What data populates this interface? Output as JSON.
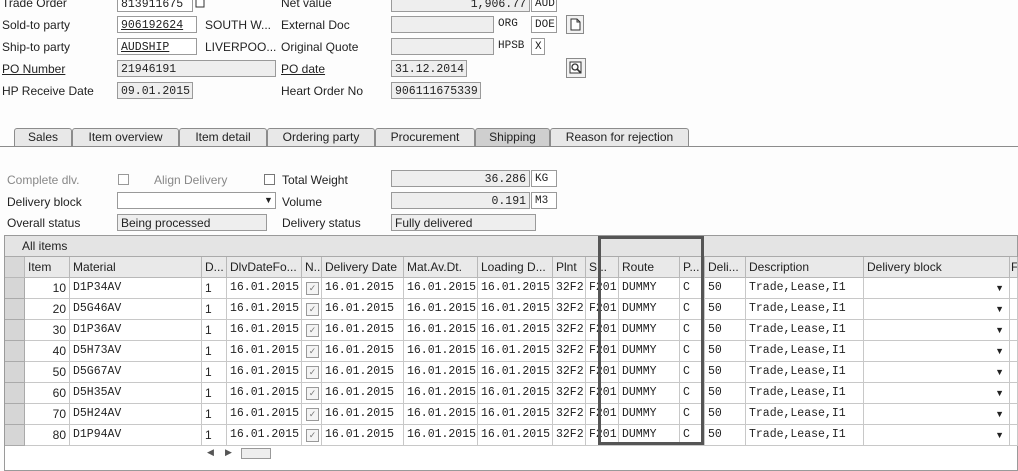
{
  "header": {
    "trade_order_label": "Trade Order",
    "trade_order_value": "813911675",
    "net_value_label": "Net value",
    "net_value": "1,906.77",
    "currency": "AUD",
    "sold_to_label": "Sold-to party",
    "sold_to_value": "906192624",
    "sold_to_name": "SOUTH W...",
    "external_doc_label": "External Doc",
    "external_doc_value": "",
    "org_code": "ORG",
    "doe_code": "DOE",
    "ship_to_label": "Ship-to party",
    "ship_to_value": "AUDSHIP",
    "ship_to_name": "LIVERPOO...",
    "original_quote_label": "Original Quote",
    "original_quote_value": "",
    "hpsb_code": "HPSB",
    "x_code": "X",
    "po_number_label": "PO Number",
    "po_number_value": "21946191",
    "po_date_label": "PO date",
    "po_date_value": "31.12.2014",
    "hp_receive_label": "HP Receive Date",
    "hp_receive_value": "09.01.2015",
    "heart_order_label": "Heart Order No",
    "heart_order_value": "906111675339"
  },
  "tabs": [
    {
      "label": "Sales",
      "active": false
    },
    {
      "label": "Item overview",
      "active": false
    },
    {
      "label": "Item detail",
      "active": false
    },
    {
      "label": "Ordering party",
      "active": false
    },
    {
      "label": "Procurement",
      "active": false
    },
    {
      "label": "Shipping",
      "active": true
    },
    {
      "label": "Reason for rejection",
      "active": false
    }
  ],
  "shipping": {
    "complete_dlv_label": "Complete dlv.",
    "align_delivery_label": "Align Delivery",
    "total_weight_label": "Total Weight",
    "total_weight_value": "36.286",
    "weight_unit": "KG",
    "delivery_block_label": "Delivery block",
    "delivery_block_value": "",
    "volume_label": "Volume",
    "volume_value": "0.191",
    "volume_unit": "M3",
    "overall_status_label": "Overall status",
    "overall_status_value": "Being processed",
    "delivery_status_label": "Delivery status",
    "delivery_status_value": "Fully delivered"
  },
  "items_table": {
    "title": "All items",
    "columns": [
      "Item",
      "Material",
      "D...",
      "DlvDateFo...",
      "N..",
      "Delivery Date",
      "Mat.Av.Dt.",
      "Loading D...",
      "Plnt",
      "S...",
      "Route",
      "P...",
      "Deli...",
      "Description",
      "Delivery block",
      "F"
    ],
    "rows": [
      {
        "item": "10",
        "material": "D1P34AV",
        "d": "1",
        "dlvdatefo": "16.01.2015",
        "delivery_date": "16.01.2015",
        "mat_av": "16.01.2015",
        "loading": "16.01.2015",
        "plnt": "32F2",
        "s": "F201",
        "route": "DUMMY",
        "p": "C",
        "deli": "50",
        "description": "Trade,Lease,I1",
        "delivery_block": ""
      },
      {
        "item": "20",
        "material": "D5G46AV",
        "d": "1",
        "dlvdatefo": "16.01.2015",
        "delivery_date": "16.01.2015",
        "mat_av": "16.01.2015",
        "loading": "16.01.2015",
        "plnt": "32F2",
        "s": "F201",
        "route": "DUMMY",
        "p": "C",
        "deli": "50",
        "description": "Trade,Lease,I1",
        "delivery_block": ""
      },
      {
        "item": "30",
        "material": "D1P36AV",
        "d": "1",
        "dlvdatefo": "16.01.2015",
        "delivery_date": "16.01.2015",
        "mat_av": "16.01.2015",
        "loading": "16.01.2015",
        "plnt": "32F2",
        "s": "F201",
        "route": "DUMMY",
        "p": "C",
        "deli": "50",
        "description": "Trade,Lease,I1",
        "delivery_block": ""
      },
      {
        "item": "40",
        "material": "D5H73AV",
        "d": "1",
        "dlvdatefo": "16.01.2015",
        "delivery_date": "16.01.2015",
        "mat_av": "16.01.2015",
        "loading": "16.01.2015",
        "plnt": "32F2",
        "s": "F201",
        "route": "DUMMY",
        "p": "C",
        "deli": "50",
        "description": "Trade,Lease,I1",
        "delivery_block": ""
      },
      {
        "item": "50",
        "material": "D5G67AV",
        "d": "1",
        "dlvdatefo": "16.01.2015",
        "delivery_date": "16.01.2015",
        "mat_av": "16.01.2015",
        "loading": "16.01.2015",
        "plnt": "32F2",
        "s": "F201",
        "route": "DUMMY",
        "p": "C",
        "deli": "50",
        "description": "Trade,Lease,I1",
        "delivery_block": ""
      },
      {
        "item": "60",
        "material": "D5H35AV",
        "d": "1",
        "dlvdatefo": "16.01.2015",
        "delivery_date": "16.01.2015",
        "mat_av": "16.01.2015",
        "loading": "16.01.2015",
        "plnt": "32F2",
        "s": "F201",
        "route": "DUMMY",
        "p": "C",
        "deli": "50",
        "description": "Trade,Lease,I1",
        "delivery_block": ""
      },
      {
        "item": "70",
        "material": "D5H24AV",
        "d": "1",
        "dlvdatefo": "16.01.2015",
        "delivery_date": "16.01.2015",
        "mat_av": "16.01.2015",
        "loading": "16.01.2015",
        "plnt": "32F2",
        "s": "F201",
        "route": "DUMMY",
        "p": "C",
        "deli": "50",
        "description": "Trade,Lease,I1",
        "delivery_block": ""
      },
      {
        "item": "80",
        "material": "D1P94AV",
        "d": "1",
        "dlvdatefo": "16.01.2015",
        "delivery_date": "16.01.2015",
        "mat_av": "16.01.2015",
        "loading": "16.01.2015",
        "plnt": "32F2",
        "s": "F201",
        "route": "DUMMY",
        "p": "C",
        "deli": "50",
        "description": "Trade,Lease,I1",
        "delivery_block": ""
      }
    ]
  },
  "icons": {
    "document": "document-icon",
    "display": "display-icon",
    "dropdown": "chevron-down-icon",
    "scroll_left": "scroll-left-icon",
    "scroll_right": "scroll-right-icon"
  }
}
